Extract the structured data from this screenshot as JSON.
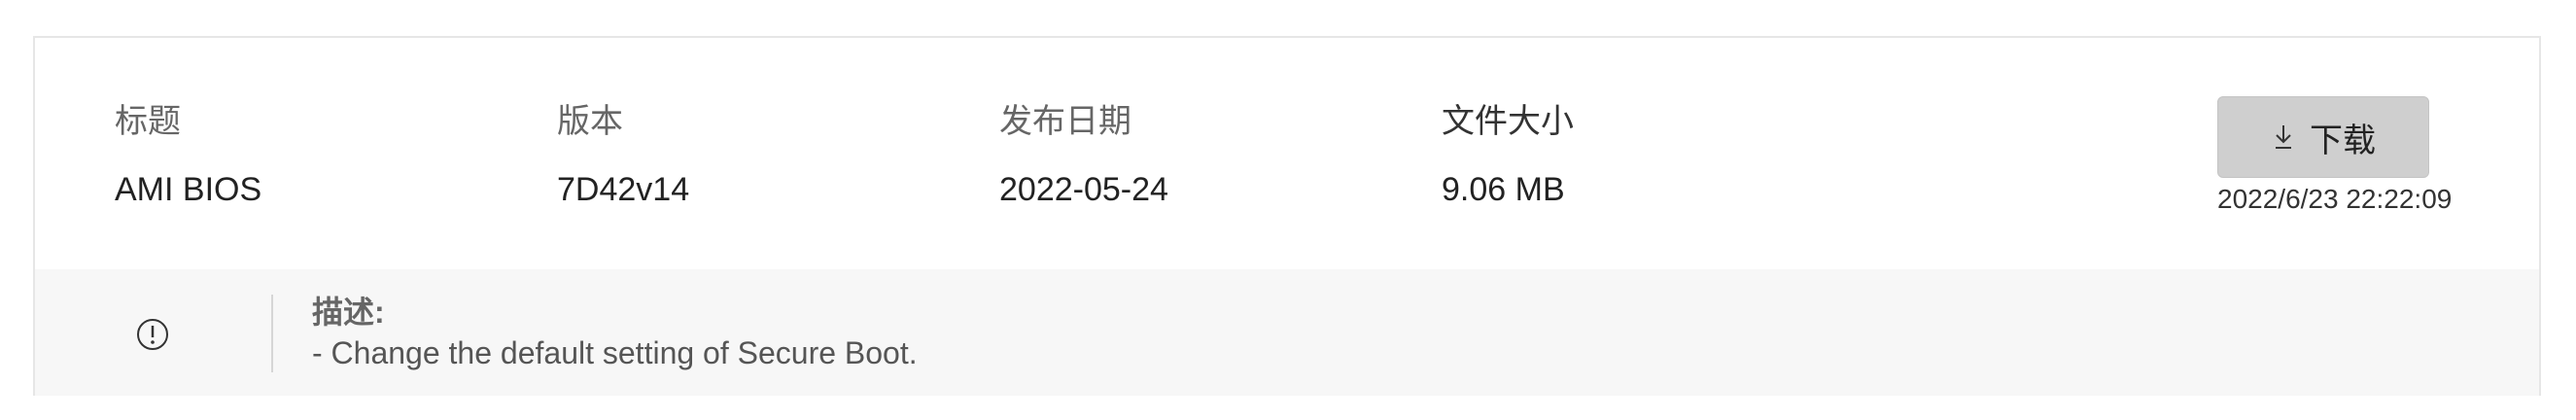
{
  "firmware": {
    "title_label": "标题",
    "title_value": "AMI BIOS",
    "version_label": "版本",
    "version_value": "7D42v14",
    "date_label": "发布日期",
    "date_value": "2022-05-24",
    "size_label": "文件大小",
    "size_value": "9.06 MB",
    "download_label": "下载",
    "download_icon": "download-arrow-icon",
    "timestamp": "2022/6/23 22:22:09"
  },
  "description": {
    "icon": "info-circle-icon",
    "heading": "描述:",
    "text": "- Change the default setting of Secure Boot."
  },
  "colors": {
    "button_bg": "#cfcfcf",
    "description_bg": "#f7f7f7",
    "border": "#e6e6e6"
  }
}
